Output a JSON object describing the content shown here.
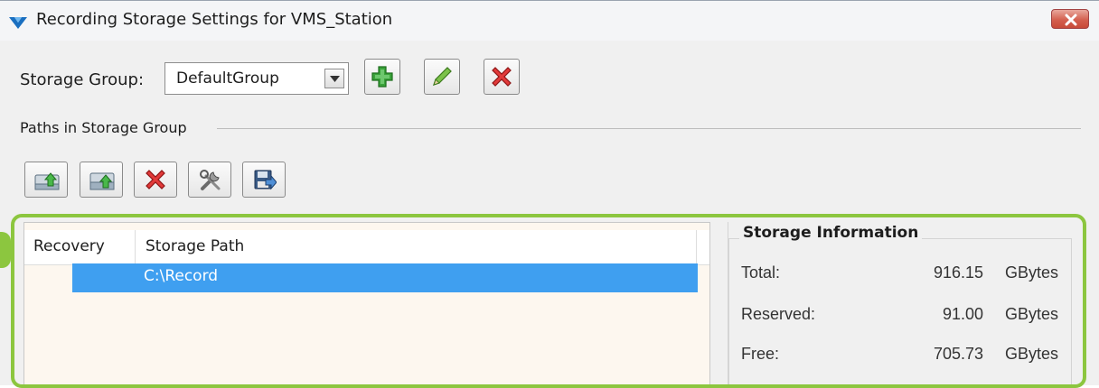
{
  "window": {
    "title": "Recording Storage Settings for VMS_Station"
  },
  "storage_group": {
    "label": "Storage Group:",
    "selected": "DefaultGroup"
  },
  "group_toolbar": [
    "add-icon",
    "edit-icon",
    "delete-icon"
  ],
  "paths_section": {
    "label": "Paths in Storage Group"
  },
  "path_toolbar": [
    "add-path-icon",
    "add-network-path-icon",
    "remove-path-icon",
    "settings-icon",
    "save-icon"
  ],
  "list": {
    "columns": [
      "Recovery",
      "Storage Path"
    ],
    "rows": [
      {
        "recovery": "",
        "path": "C:\\Record"
      }
    ]
  },
  "storage_info": {
    "title": "Storage Information",
    "items": [
      {
        "label": "Total:",
        "value": "916.15",
        "unit": "GBytes"
      },
      {
        "label": "Reserved:",
        "value": "91.00",
        "unit": "GBytes"
      },
      {
        "label": "Free:",
        "value": "705.73",
        "unit": "GBytes"
      }
    ]
  },
  "colors": {
    "highlight": "#8cc63f",
    "selection": "#3f9ff0",
    "close": "#d4604f"
  }
}
